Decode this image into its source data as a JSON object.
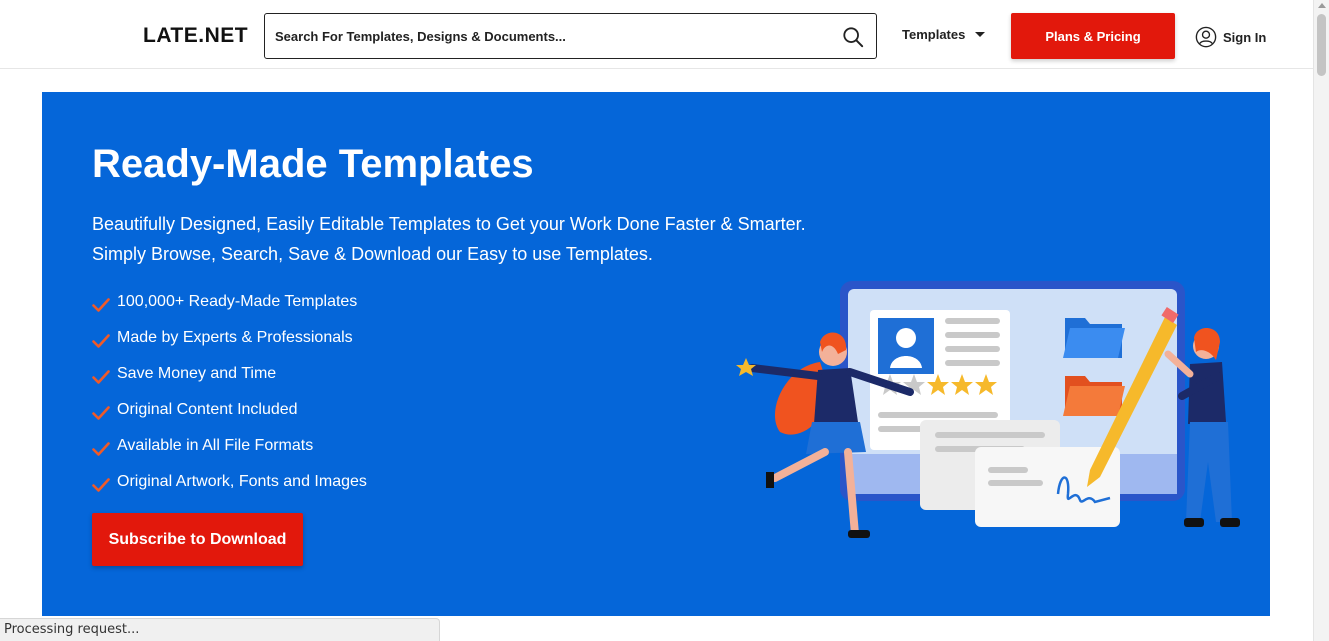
{
  "header": {
    "logo_text": "LATE.NET",
    "search_placeholder": "Search For Templates, Designs & Documents...",
    "nav_templates": "Templates",
    "plans_button": "Plans & Pricing",
    "sign_in": "Sign In"
  },
  "hero": {
    "title": "Ready-Made Templates",
    "subtitle_line1": "Beautifully Designed, Easily Editable Templates to Get your Work Done Faster & Smarter.",
    "subtitle_line2": "Simply Browse, Search, Save & Download our Easy to use Templates.",
    "features": [
      "100,000+ Ready-Made Templates",
      "Made by Experts & Professionals",
      "Save Money and Time",
      "Original Content Included",
      "Available in All File Formats",
      "Original Artwork, Fonts and Images"
    ],
    "cta_button": "Subscribe to Download"
  },
  "status_bar": "Processing request...",
  "colors": {
    "brand_red": "#e2180c",
    "hero_blue": "#0566d9",
    "check_color": "#f05a28"
  },
  "icons": [
    "search-icon",
    "caret-down-icon",
    "user-icon",
    "check-icon"
  ]
}
